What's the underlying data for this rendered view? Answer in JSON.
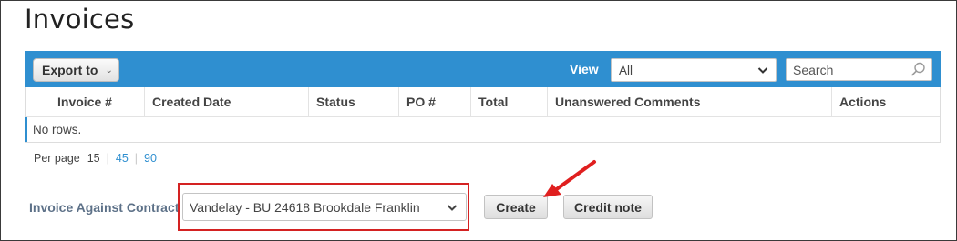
{
  "page": {
    "title": "Invoices"
  },
  "toolbar": {
    "export_label": "Export to",
    "view_label": "View",
    "view_value": "All",
    "search_placeholder": "Search"
  },
  "table": {
    "columns": [
      "Invoice #",
      "Created Date",
      "Status",
      "PO #",
      "Total",
      "Unanswered Comments",
      "Actions"
    ],
    "empty_text": "No rows."
  },
  "pager": {
    "label": "Per page",
    "options": [
      "15",
      "45",
      "90"
    ],
    "current": "15"
  },
  "contract": {
    "label": "Invoice Against Contract",
    "selected": "Vandelay - BU 24618 Brookdale Franklin"
  },
  "actions": {
    "create_label": "Create",
    "credit_label": "Credit note"
  },
  "colors": {
    "accent": "#2f8fd0",
    "highlight": "#d42222"
  },
  "icons": {
    "export_chevron": "chevron-down-icon",
    "view_caret": "chevron-down-icon",
    "search": "search-icon",
    "annotation": "red-arrow-icon"
  }
}
